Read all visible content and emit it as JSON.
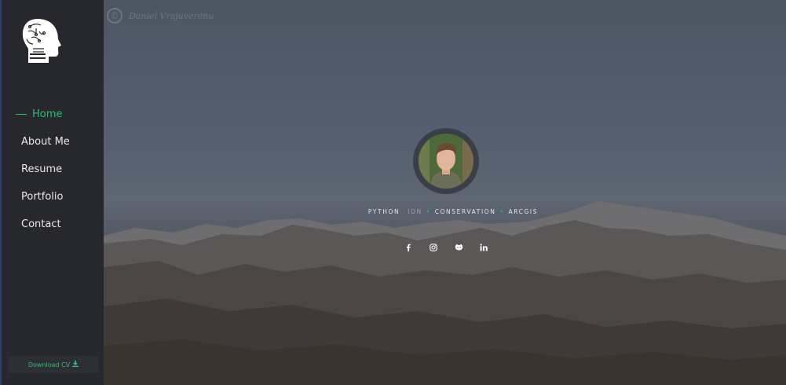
{
  "sidebar": {
    "nav_items": [
      {
        "label": "Home",
        "active": true
      },
      {
        "label": "About Me",
        "active": false
      },
      {
        "label": "Resume",
        "active": false
      },
      {
        "label": "Portfolio",
        "active": false
      },
      {
        "label": "Contact",
        "active": false
      }
    ],
    "download_label": "Download CV"
  },
  "hero": {
    "watermark_symbol": "©",
    "watermark_text": "Daniel Vrajuverenu",
    "tagline": {
      "part1": "PYTHON",
      "part2_faded": "ION",
      "part3": "CONSERVATION",
      "part4": "ARCGIS"
    },
    "socials": [
      "facebook-icon",
      "instagram-icon",
      "github-icon",
      "linkedin-icon"
    ]
  },
  "colors": {
    "accent": "#2fbf71",
    "sidebar_bg": "#26282e"
  }
}
